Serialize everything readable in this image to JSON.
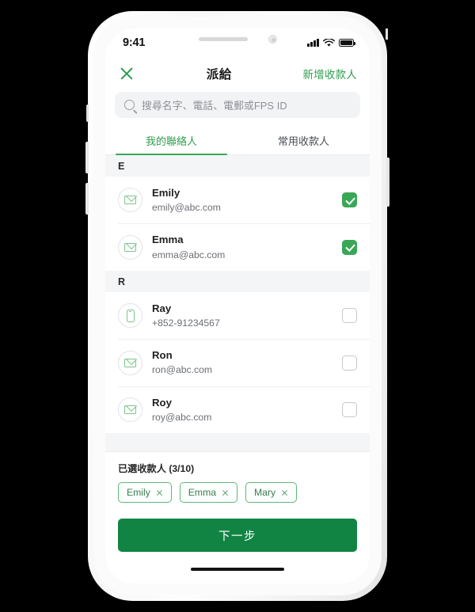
{
  "status_bar": {
    "time": "9:41",
    "icons": [
      "cellular-signal-icon",
      "wifi-icon",
      "battery-icon"
    ]
  },
  "header": {
    "close_icon": "close-icon",
    "title": "派給",
    "action_label": "新增收款人"
  },
  "search": {
    "icon": "search-icon",
    "placeholder": "搜尋名字、電話、電郵或FPS ID",
    "value": ""
  },
  "tabs": [
    {
      "label": "我的聯絡人",
      "active": true
    },
    {
      "label": "常用收款人",
      "active": false
    }
  ],
  "contact_sections": [
    {
      "letter": "E",
      "contacts": [
        {
          "name": "Emily",
          "detail": "emily@abc.com",
          "icon": "mail-icon",
          "checked": true
        },
        {
          "name": "Emma",
          "detail": "emma@abc.com",
          "icon": "mail-icon",
          "checked": true
        }
      ]
    },
    {
      "letter": "R",
      "contacts": [
        {
          "name": "Ray",
          "detail": "+852-91234567",
          "icon": "phone-icon",
          "checked": false
        },
        {
          "name": "Ron",
          "detail": "ron@abc.com",
          "icon": "mail-icon",
          "checked": false
        },
        {
          "name": "Roy",
          "detail": "roy@abc.com",
          "icon": "mail-icon",
          "checked": false
        }
      ]
    }
  ],
  "selected": {
    "title": "已選收款人 (3/10)",
    "count": 3,
    "max": 10,
    "chips": [
      {
        "label": "Emily"
      },
      {
        "label": "Emma"
      },
      {
        "label": "Mary"
      }
    ]
  },
  "cta": {
    "label": "下一步"
  },
  "colors": {
    "brand_green": "#2e9e4f",
    "cta_green": "#118443",
    "checkbox_green": "#3aa757",
    "tab_underline": "#38a85a",
    "chip_border": "#62b87a",
    "list_bg": "#f4f5f6",
    "search_bg": "#f2f3f5",
    "page_bg": "#000000"
  }
}
